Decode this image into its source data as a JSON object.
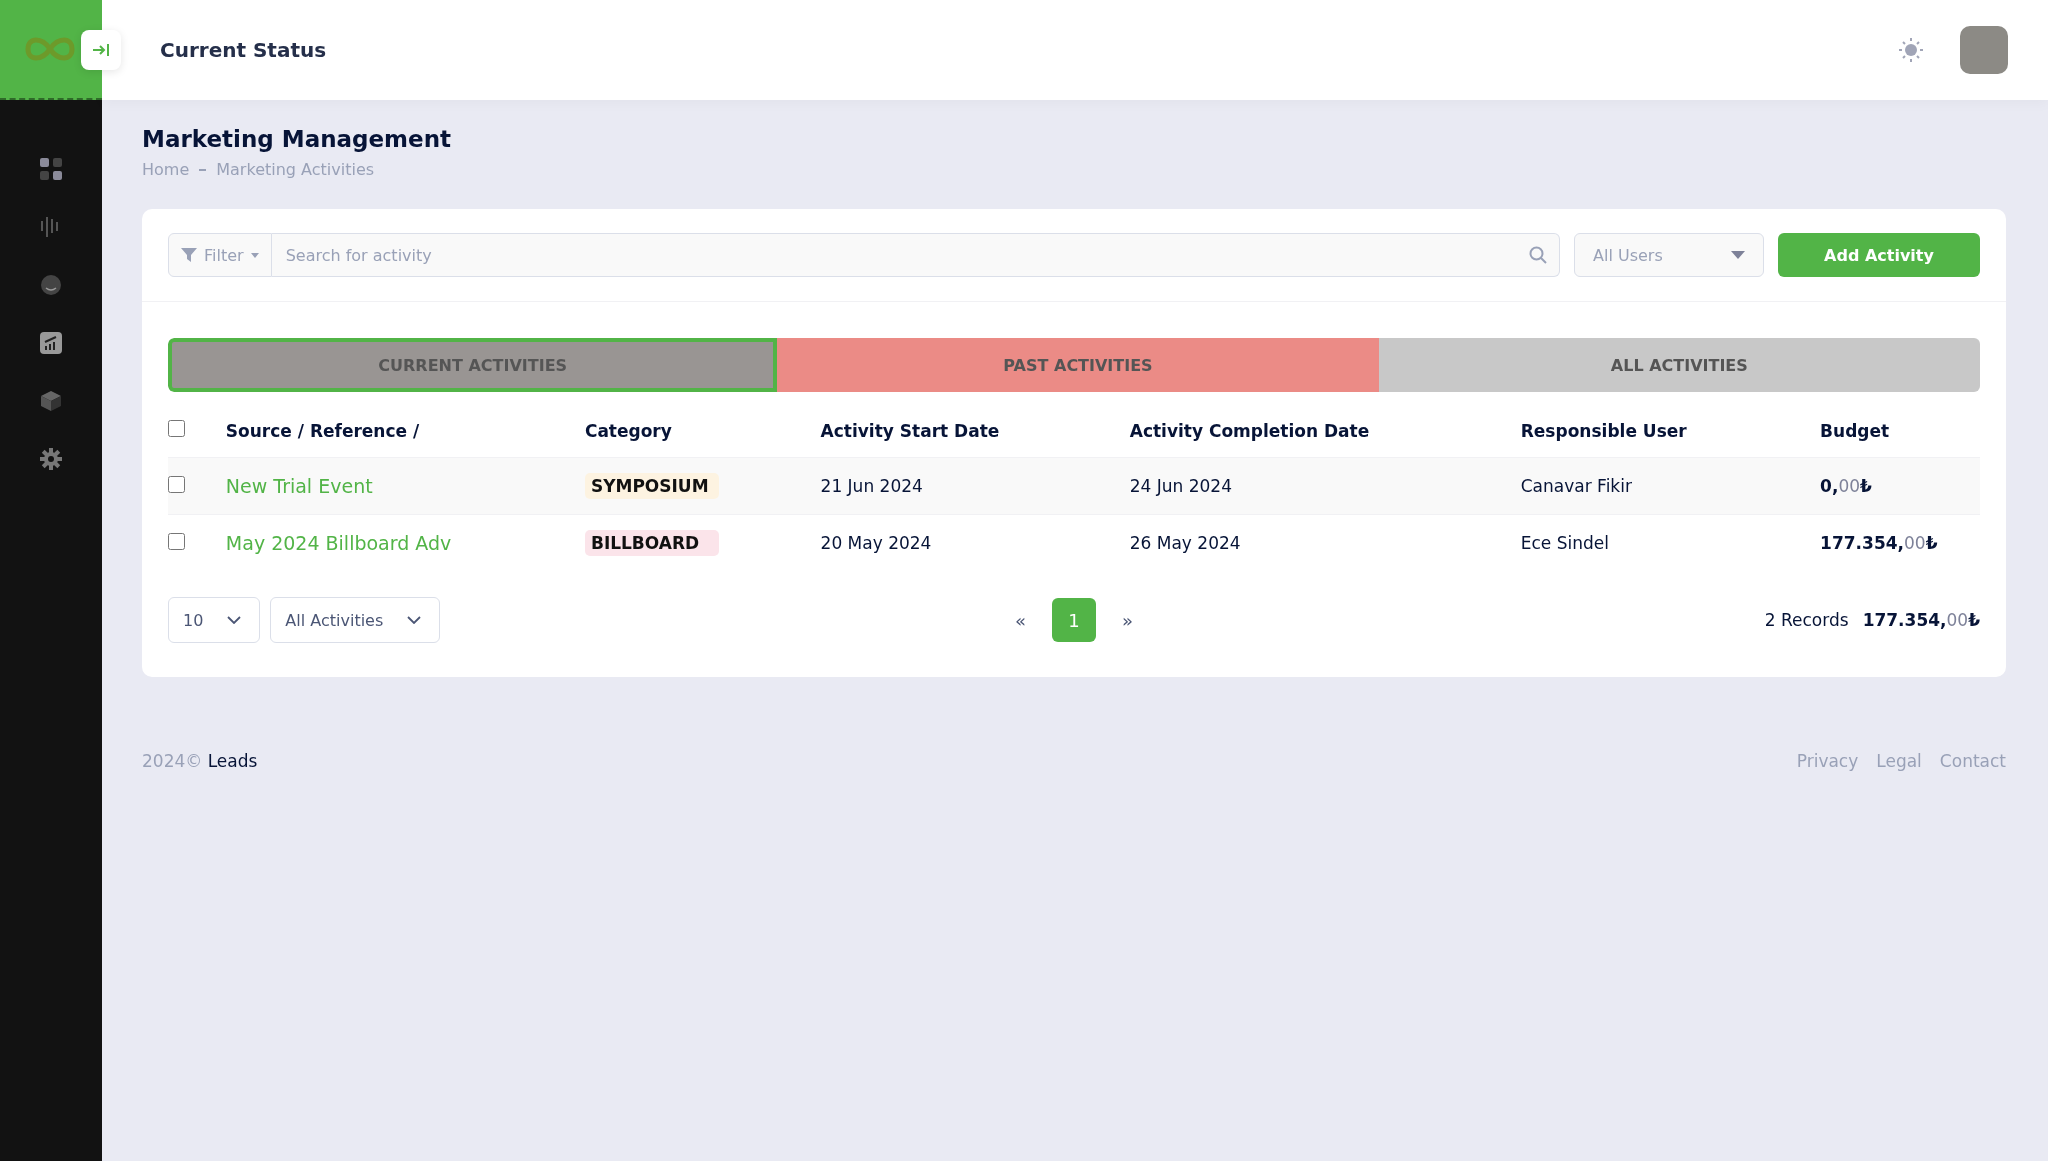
{
  "header": {
    "title": "Current Status"
  },
  "sidebar": {
    "items": [
      {
        "kind": "grid",
        "selected": false
      },
      {
        "kind": "bars",
        "selected": false
      },
      {
        "kind": "circle",
        "selected": false
      },
      {
        "kind": "chart",
        "selected": false
      },
      {
        "kind": "cube",
        "selected": false
      },
      {
        "kind": "gear",
        "selected": false
      }
    ]
  },
  "page": {
    "title": "Marketing Management",
    "breadcrumb": [
      "Home",
      "Marketing Activities"
    ]
  },
  "toolbar": {
    "filter": "Filter",
    "search": {
      "placeholder": "Search for activity"
    },
    "users": {
      "value": "All Users"
    },
    "add_button": "Add Activity"
  },
  "tabs": [
    {
      "label": "CURRENT ACTIVITIES",
      "selected": true,
      "color": "#999593"
    },
    {
      "label": "PAST ACTIVITIES",
      "selected": false,
      "color": "#eb8b86"
    },
    {
      "label": "ALL ACTIVITIES",
      "selected": false,
      "color": "#c8c8c8"
    }
  ],
  "table": {
    "select_all": false,
    "columns": [
      "Source / Reference /",
      "Category",
      "Activity Start Date",
      "Activity Completion Date",
      "Responsible User",
      "Budget"
    ],
    "rows": [
      {
        "checked": false,
        "source": "New Trial Event",
        "category": {
          "label": "SYMPOSIUM",
          "color": "#fdf3e1"
        },
        "start": "21 Jun 2024",
        "end": "24 Jun 2024",
        "user": "Canavar Fikir",
        "budget": {
          "integer": "0,",
          "decimals": "00",
          "currency": "₺"
        }
      },
      {
        "checked": false,
        "source": "May 2024 Billboard Adv",
        "category": {
          "label": "BILLBOARD",
          "color": "#fbe4ea"
        },
        "start": "20 May 2024",
        "end": "26 May 2024",
        "user": "Ece Sindel",
        "budget": {
          "integer": "177.354,",
          "decimals": "00",
          "currency": "₺"
        }
      }
    ]
  },
  "footer_bar": {
    "page_size": "10",
    "activity_filter": "All Activities",
    "prev": "«",
    "pages": [
      {
        "label": "1",
        "selected": true
      }
    ],
    "next": "»",
    "records": "2 Records",
    "total": {
      "integer": "177.354,",
      "decimals": "00",
      "currency": "₺"
    }
  },
  "footer": {
    "year": "2024©",
    "brand": "Leads",
    "links": [
      "Privacy",
      "Legal",
      "Contact"
    ]
  }
}
